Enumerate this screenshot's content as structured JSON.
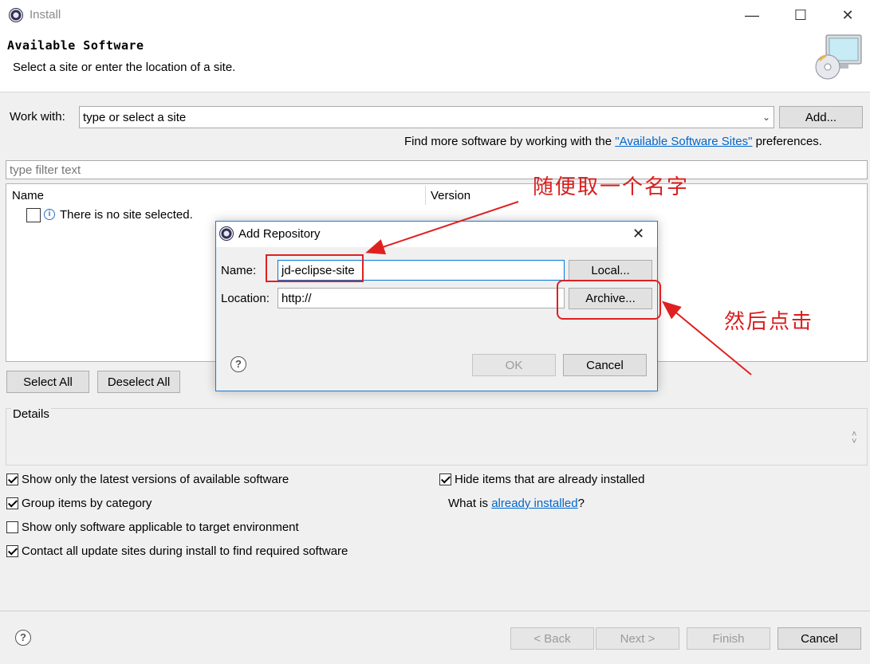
{
  "window": {
    "title": "Install",
    "minimize": "—",
    "maximize": "☐",
    "close": "✕"
  },
  "header": {
    "title": "Available Software",
    "subtitle": "Select a site or enter the location of a site."
  },
  "work_with": {
    "label": "Work with:",
    "placeholder": "type or select a site",
    "add_button": "Add...",
    "find_more_prefix": "Find more software by working with the",
    "find_more_link": "\"Available Software Sites\"",
    "find_more_suffix": "preferences."
  },
  "filter": {
    "placeholder": "type filter text"
  },
  "table": {
    "columns": [
      "Name",
      "Version"
    ],
    "empty_row": "There is no site selected."
  },
  "selection_buttons": {
    "select_all": "Select All",
    "deselect_all": "Deselect All"
  },
  "details": {
    "label": "Details"
  },
  "options": {
    "latest_versions": {
      "label": "Show only the latest versions of available software",
      "checked": true
    },
    "group_by_category": {
      "label": "Group items by category",
      "checked": true
    },
    "target_env": {
      "label": "Show only software applicable to target environment",
      "checked": false
    },
    "contact_sites": {
      "label": "Contact all update sites during install to find required software",
      "checked": true
    },
    "hide_installed": {
      "label": "Hide items that are already installed",
      "checked": true
    },
    "what_is_prefix": "What is",
    "what_is_link": "already installed",
    "what_is_suffix": "?"
  },
  "footer": {
    "back": "< Back",
    "next": "Next >",
    "finish": "Finish",
    "cancel": "Cancel",
    "help": "?"
  },
  "dialog": {
    "title": "Add Repository",
    "close": "✕",
    "name_label": "Name:",
    "name_value": "jd-eclipse-site",
    "location_label": "Location:",
    "location_value": "http://",
    "local_button": "Local...",
    "archive_button": "Archive...",
    "ok_button": "OK",
    "cancel_button": "Cancel",
    "help": "?"
  },
  "annotations": {
    "name_hint": "随便取一个名字",
    "archive_hint": "然后点击",
    "color": "#d81e1e"
  },
  "colors": {
    "accent": "#0078d7",
    "link": "#0066cc",
    "annotation": "#e02020"
  }
}
